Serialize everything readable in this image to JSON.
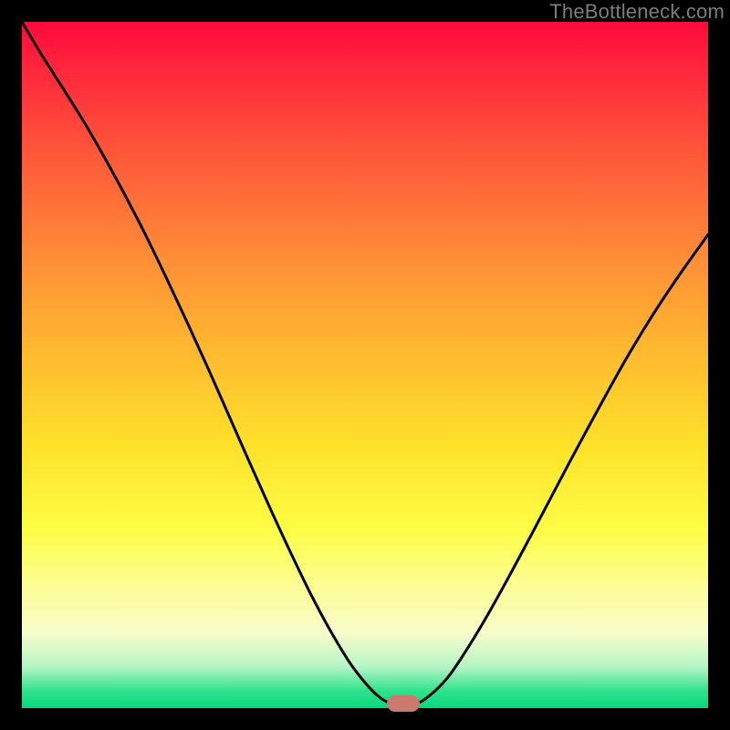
{
  "watermark": "TheBottleneck.com",
  "marker": {
    "x_frac": 0.556,
    "y_frac": 0.994,
    "color": "#cc7a6e"
  },
  "chart_data": {
    "type": "line",
    "title": "",
    "xlabel": "",
    "ylabel": "",
    "xlim": [
      0,
      100
    ],
    "ylim": [
      0,
      100
    ],
    "grid": false,
    "legend": false,
    "series": [
      {
        "name": "curve",
        "x": [
          0,
          3,
          6,
          9,
          12,
          15,
          18,
          21,
          24,
          27,
          30,
          33,
          36,
          39,
          42,
          45,
          48,
          51,
          53,
          55,
          57,
          59,
          62,
          65,
          68,
          71,
          74,
          77,
          80,
          84,
          88,
          92,
          96,
          100
        ],
        "y": [
          100,
          95,
          90.3,
          85.5,
          80.3,
          74.8,
          69,
          62.8,
          56.4,
          49.8,
          43,
          36.2,
          29.5,
          23,
          16.8,
          11.2,
          6.3,
          2.6,
          1,
          0.4,
          0.5,
          1.5,
          4.4,
          8.8,
          13.8,
          19.2,
          24.8,
          30.5,
          36.2,
          43.6,
          50.8,
          57.4,
          63.4,
          69
        ]
      }
    ],
    "annotations": [
      {
        "type": "marker",
        "shape": "pill",
        "x": 55.6,
        "y": 0.6,
        "color": "#cc7a6e"
      }
    ],
    "background": {
      "type": "vertical-gradient",
      "stops": [
        {
          "pos": 0.0,
          "color": "#ff0a3c"
        },
        {
          "pos": 0.2,
          "color": "#ff5a3a"
        },
        {
          "pos": 0.48,
          "color": "#ffb930"
        },
        {
          "pos": 0.74,
          "color": "#fdfd45"
        },
        {
          "pos": 0.94,
          "color": "#b4f5c6"
        },
        {
          "pos": 1.0,
          "color": "#06d87d"
        }
      ]
    }
  }
}
